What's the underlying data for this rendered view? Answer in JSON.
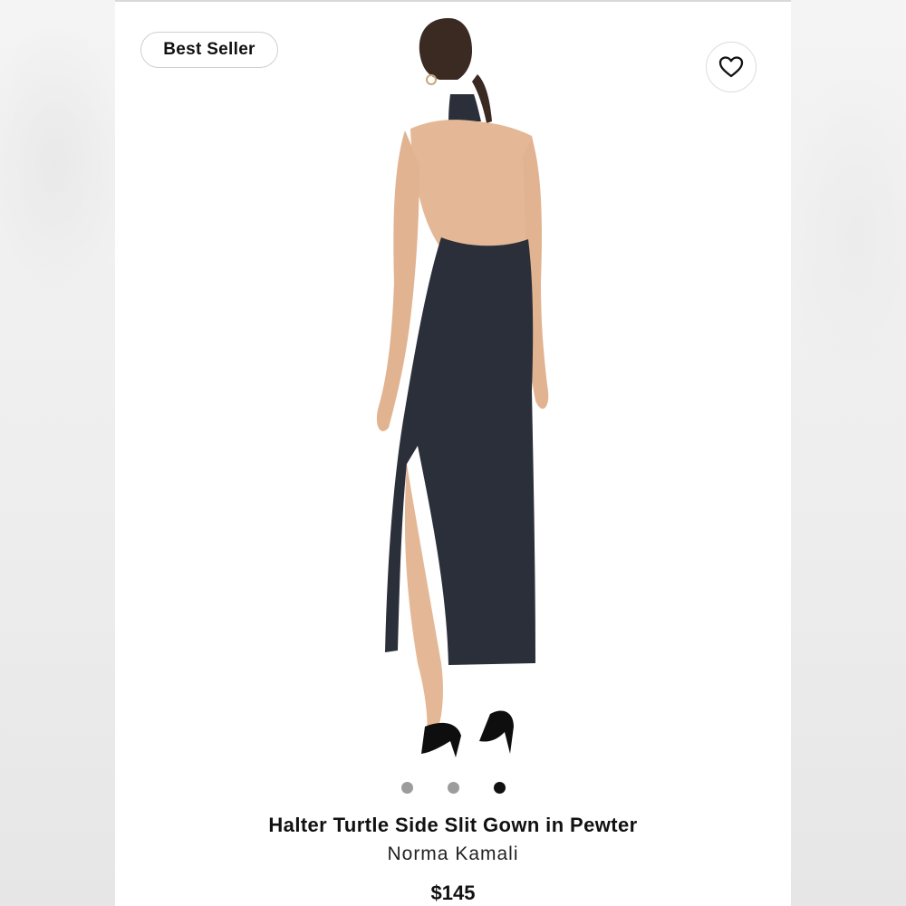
{
  "badge": {
    "label": "Best Seller"
  },
  "favorite": {
    "icon": "heart-icon"
  },
  "product": {
    "title": "Halter Turtle Side Slit Gown in Pewter",
    "brand": "Norma Kamali",
    "price": "$145",
    "image": "product-photo-back-view"
  },
  "carousel": {
    "count": 3,
    "active_index": 2
  },
  "colors": {
    "dress": "#2b2f3a",
    "skin": "#e4b896",
    "dot_inactive": "#9c9c9c",
    "dot_active": "#111111"
  }
}
